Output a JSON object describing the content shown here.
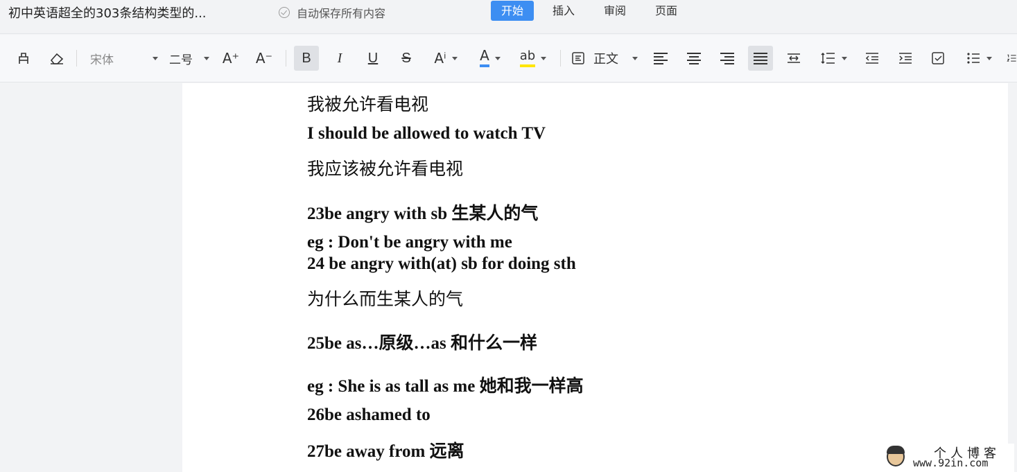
{
  "title_bar": {
    "doc_title": "初中英语超全的303条结构类型的...",
    "autosave_text": "自动保存所有内容",
    "tabs": [
      {
        "label": "开始",
        "active": true
      },
      {
        "label": "插入",
        "active": false
      },
      {
        "label": "审阅",
        "active": false
      },
      {
        "label": "页面",
        "active": false
      }
    ]
  },
  "toolbar": {
    "font_family": "宋体",
    "font_size": "二号",
    "increase_font": "A⁺",
    "decrease_font": "A⁻",
    "bold": "B",
    "italic": "I",
    "underline": "U",
    "strikethrough": "S",
    "superscript": "Aⁱ",
    "font_color": "A",
    "highlight": "ab",
    "paragraph_style": "正文",
    "colors": {
      "font_color": "#3d8ef2",
      "highlight": "#ffe600",
      "accent": "#3d8ef2"
    }
  },
  "document": {
    "lines": [
      {
        "text": "我被允许看电视",
        "style": "cn"
      },
      {
        "text": "I should be allowed to watch TV",
        "style": "en"
      },
      {
        "text": "我应该被允许看电视",
        "style": "cn"
      },
      {
        "text": "23be angry with sb  生某人的气",
        "style": "en"
      },
      {
        "text": "eg : Don't be angry with me",
        "style": "en"
      },
      {
        "text": "24 be angry with(at) sb for doing sth",
        "style": "en"
      },
      {
        "text": "为什么而生某人的气",
        "style": "cn"
      },
      {
        "text": "25be as…原级…as  和什么一样",
        "style": "en"
      },
      {
        "text": "eg : She is as tall as me  她和我一样高",
        "style": "en"
      },
      {
        "text": "26be ashamed to",
        "style": "en"
      },
      {
        "text": "27be away from  远离",
        "style": "en"
      }
    ]
  },
  "watermark": {
    "title": "个人博客",
    "url": "www.92in.com"
  }
}
